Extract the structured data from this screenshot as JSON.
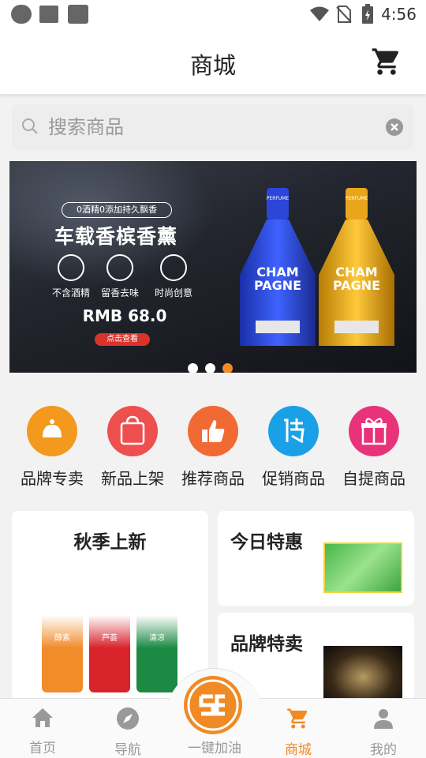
{
  "status": {
    "time": "4:56"
  },
  "header": {
    "title": "商城"
  },
  "search": {
    "placeholder": "搜索商品"
  },
  "banner": {
    "tagline": "0酒精0添加持久飘香",
    "headline": "车载香槟香薰",
    "features": [
      "不含酒精",
      "留香去味",
      "时尚创意"
    ],
    "price": "RMB 68.0",
    "cta": "点击查看",
    "bottle_text": "CHAM PAGNE",
    "bottle_top": "PERFUME",
    "slide_index": 3,
    "slide_count": 3
  },
  "categories": [
    {
      "label": "品牌专卖",
      "icon": "brand-icon",
      "color": "#f39a1e"
    },
    {
      "label": "新品上架",
      "icon": "new-arrival-bag-icon",
      "color": "#ee4f4f"
    },
    {
      "label": "推荐商品",
      "icon": "thumbs-up-icon",
      "color": "#f26a33"
    },
    {
      "label": "促销商品",
      "icon": "promotion-icon",
      "color": "#1aa0e6"
    },
    {
      "label": "自提商品",
      "icon": "gift-icon",
      "color": "#e8337a"
    }
  ],
  "cards": {
    "autumn": {
      "title": "秋季上新",
      "product_labels": [
        "酵素",
        "芦荟",
        "清凉"
      ]
    },
    "today": {
      "title": "今日特惠"
    },
    "brand": {
      "title": "品牌特卖"
    }
  },
  "tabbar": {
    "items": [
      {
        "label": "首页",
        "icon": "home-icon"
      },
      {
        "label": "导航",
        "icon": "compass-icon"
      },
      {
        "label": "一键加油",
        "icon": "fuel-logo-icon"
      },
      {
        "label": "商城",
        "icon": "cart-icon",
        "active": true
      },
      {
        "label": "我的",
        "icon": "person-icon"
      }
    ]
  },
  "colors": {
    "accent": "#f08a24",
    "text": "#222222",
    "muted": "#999999"
  }
}
